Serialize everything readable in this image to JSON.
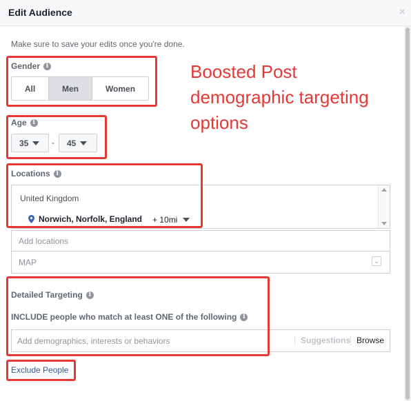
{
  "dialog": {
    "title": "Edit Audience",
    "close_icon": "×",
    "hint": "Make sure to save your edits once you're done."
  },
  "gender": {
    "label": "Gender",
    "options": [
      "All",
      "Men",
      "Women"
    ],
    "selected": "Men"
  },
  "age": {
    "label": "Age",
    "min": "35",
    "max": "45",
    "separator": "-"
  },
  "locations": {
    "label": "Locations",
    "country": "United Kingdom",
    "city": "Norwich, Norfolk, England",
    "radius": "+ 10mi",
    "add_placeholder": "Add locations",
    "map_label": "MAP"
  },
  "detailed_targeting": {
    "label": "Detailed Targeting",
    "include_text": "INCLUDE people who match at least ONE of the following",
    "placeholder": "Add demographics, interests or behaviors",
    "suggestions": "Suggestions",
    "browse": "Browse"
  },
  "exclude_link": "Exclude People",
  "annotation": {
    "text_lines": [
      "Boosted Post",
      "demographic targeting",
      "options"
    ],
    "color": "#e53935"
  },
  "colors": {
    "link": "#365899",
    "selected_segment": "#dddfe2"
  }
}
